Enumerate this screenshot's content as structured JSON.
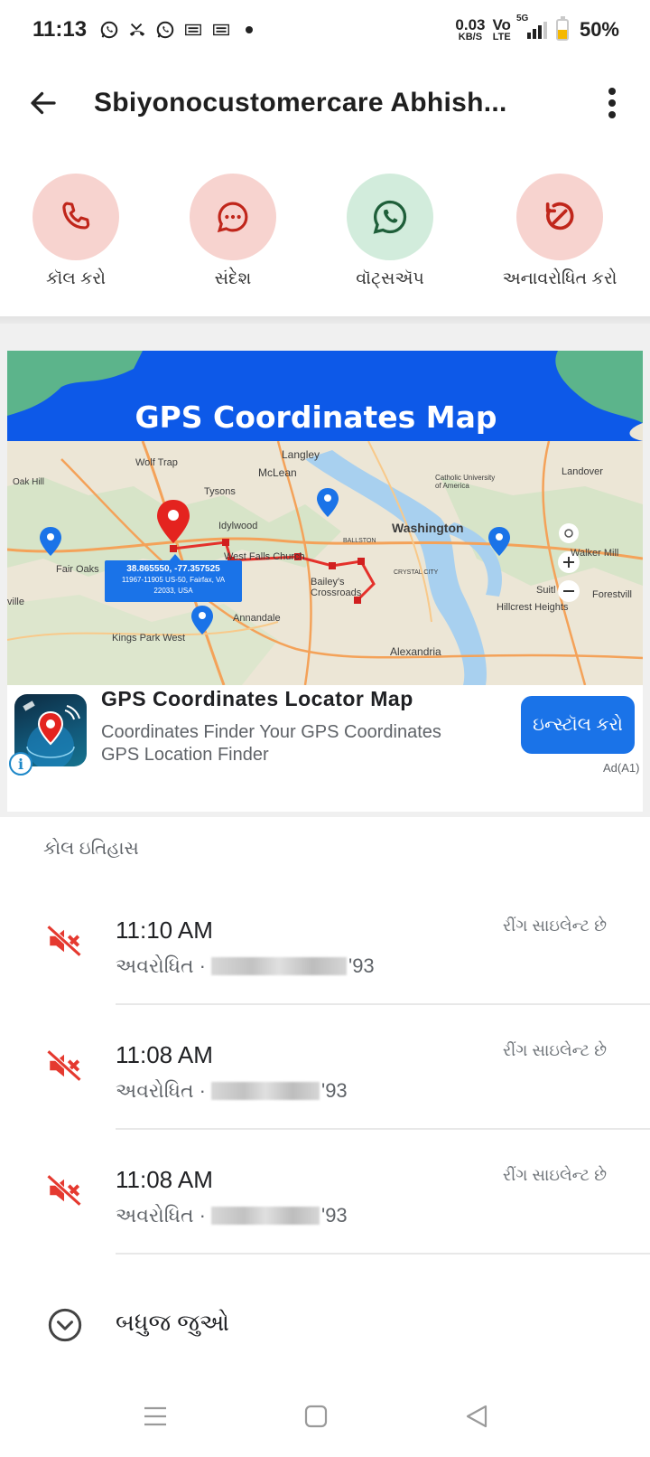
{
  "status_bar": {
    "time": "11:13",
    "net_speed_value": "0.03",
    "net_speed_unit": "KB/S",
    "volte_top": "Vo",
    "volte_bottom": "LTE",
    "network": "5G",
    "battery_percent": "50%",
    "battery_level": 0.5
  },
  "header": {
    "title": "Sbiyonocustomercare Abhish..."
  },
  "actions": [
    {
      "label": "કૉલ કરો",
      "icon": "phone-icon",
      "color": "#c0261b"
    },
    {
      "label": "સંદેશ",
      "icon": "message-icon",
      "color": "#c0261b"
    },
    {
      "label": "વૉટ્સઍપ",
      "icon": "whatsapp-icon",
      "color": "#1f5f3a"
    },
    {
      "label": "અનાવરોધિત કરો",
      "icon": "unblock-icon",
      "color": "#c0261b"
    }
  ],
  "ad": {
    "banner_title": "GPS Coordinates Map",
    "map_labels": [
      "Langley",
      "Wolf Trap",
      "McLean",
      "Oak Hill",
      "Tysons",
      "Idylwood",
      "Washington",
      "Catholic University of America",
      "Landover",
      "Fair Oaks",
      "West Falls Church",
      "Bailey's Crossroads",
      "Annandale",
      "Kings Park West",
      "Hillcrest Heights",
      "Alexandria",
      "Walker Mill",
      "Forestvill",
      "Suitl",
      "ville",
      "BALLSTON",
      "CRYSTAL CITY"
    ],
    "coord_line1": "38.865550, -77.357525",
    "coord_line2": "11967-11905 US-50, Fairfax, VA",
    "coord_line3": "22033, USA",
    "app_title": "GPS Coordinates Locator Map",
    "app_desc_line1": "Coordinates Finder Your GPS Coordinates",
    "app_desc_line2": "GPS Location Finder",
    "install_label": "ઇન્સ્ટૉલ કરો",
    "ad_label": "Ad(A1)",
    "info_glyph": "i"
  },
  "history": {
    "title": "કોલ ઇતિહાસ",
    "calls": [
      {
        "time": "11:10 AM",
        "type": "અવરોધિત ·",
        "number_suffix": "'93",
        "status": "રીંગ સાઇલેન્ટ છે"
      },
      {
        "time": "11:08 AM",
        "type": "અવરોધિત ·",
        "number_suffix": "'93",
        "status": "રીંગ સાઇલેન્ટ છે"
      },
      {
        "time": "11:08 AM",
        "type": "અવરોધિત ·",
        "number_suffix": "'93",
        "status": "રીંગ સાઇલેન્ટ છે"
      }
    ],
    "see_all_label": "બધુજ જુઓ"
  }
}
